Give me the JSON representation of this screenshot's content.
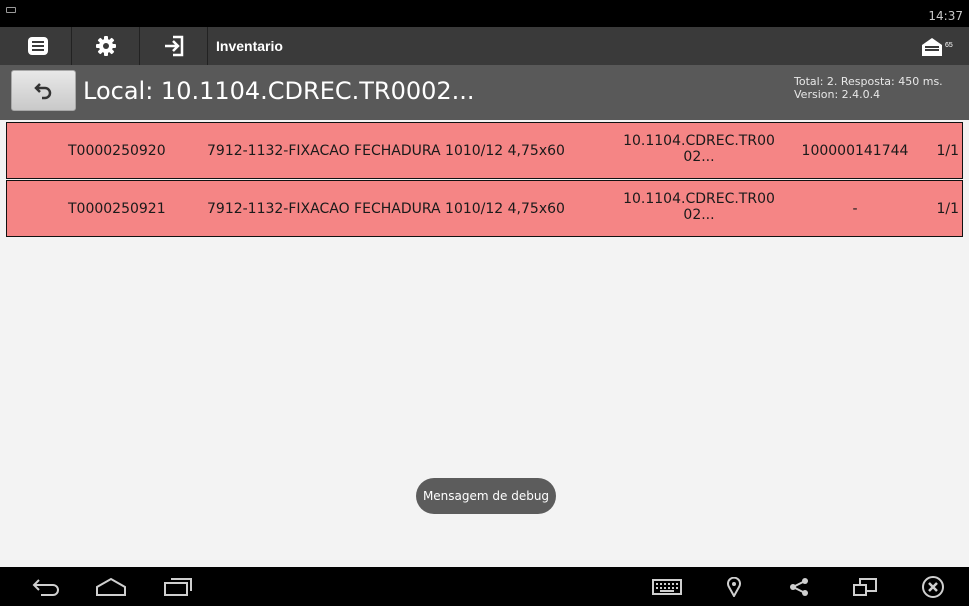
{
  "status_bar": {
    "time": "14:37"
  },
  "action_bar": {
    "title": "Inventario",
    "icons": [
      "list-icon",
      "gear-icon",
      "login-icon"
    ],
    "mail_badge": "65"
  },
  "location_header": {
    "title": "Local: 10.1104.CDREC.TR0002...",
    "info_line1": "Total: 2. Resposta: 450 ms.",
    "info_line2": "Version: 2.4.0.4"
  },
  "rows": [
    {
      "code": "T0000250920",
      "description": "7912-1132-FIXACAO FECHADURA 1010/12 4,75x60",
      "location_line1": "10.1104.CDREC.TR00",
      "location_line2": "02...",
      "lot": "100000141744",
      "quantity": "1/1"
    },
    {
      "code": "T0000250921",
      "description": "7912-1132-FIXACAO FECHADURA 1010/12 4,75x60",
      "location_line1": "10.1104.CDREC.TR00",
      "location_line2": "02...",
      "lot": "-",
      "quantity": "1/1"
    }
  ],
  "toast": {
    "text": "Mensagem de debug"
  },
  "nav_bar": {
    "icons": [
      "back-icon",
      "home-icon",
      "recent-apps-icon",
      "keyboard-icon",
      "location-icon",
      "share-icon",
      "rotate-icon",
      "close-icon"
    ]
  },
  "colors": {
    "row_background": "#f58585",
    "action_bar": "#3a3a3a",
    "header": "#595959",
    "content_background": "#f3f3f3"
  }
}
